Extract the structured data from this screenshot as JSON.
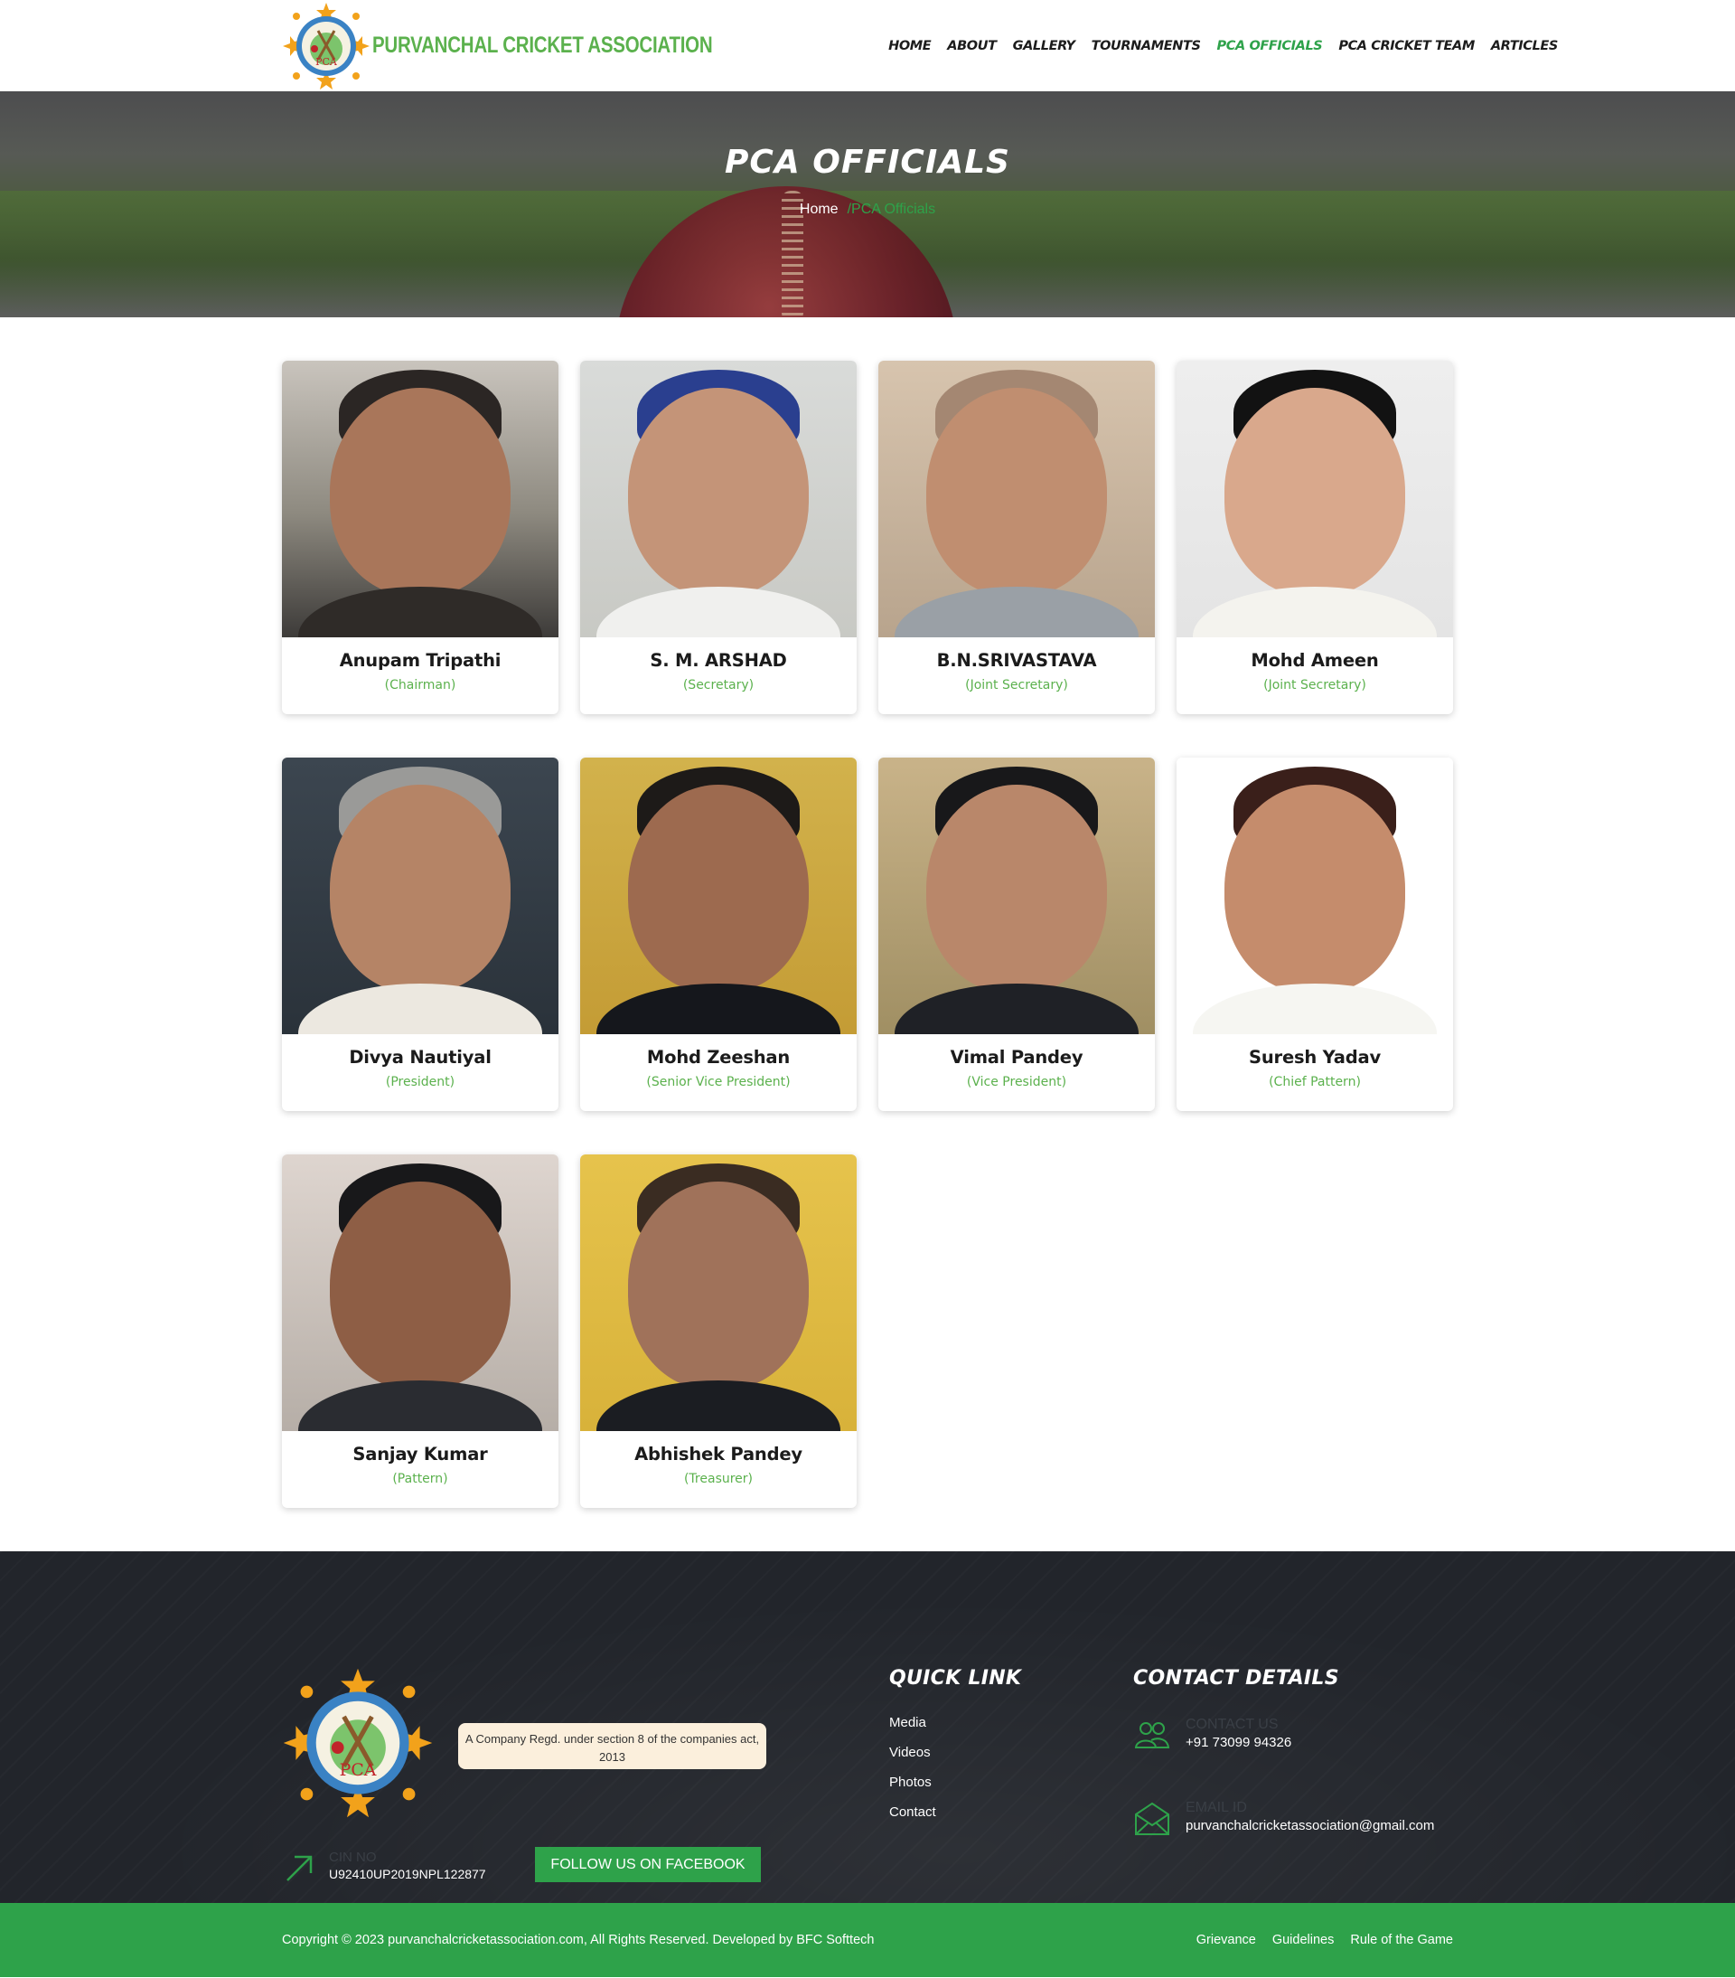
{
  "header": {
    "logo_text": "PURVANCHAL CRICKET ASSOCIATION",
    "logo_badge_text": "PCA",
    "nav": [
      {
        "label": "HOME",
        "active": false
      },
      {
        "label": "ABOUT",
        "active": false
      },
      {
        "label": "GALLERY",
        "active": false
      },
      {
        "label": "TOURNAMENTS",
        "active": false
      },
      {
        "label": "PCA OFFICIALS",
        "active": true
      },
      {
        "label": "PCA CRICKET TEAM",
        "active": false
      },
      {
        "label": "ARTICLES",
        "active": false
      }
    ]
  },
  "hero": {
    "title": "PCA OFFICIALS",
    "breadcrumb_home": "Home",
    "breadcrumb_current": "/PCA Officials"
  },
  "officials": [
    {
      "name": "Anupam Tripathi",
      "role": "(Chairman)"
    },
    {
      "name": "S. M. ARSHAD",
      "role": "(Secretary)"
    },
    {
      "name": "B.N.SRIVASTAVA",
      "role": "(Joint Secretary)"
    },
    {
      "name": "Mohd Ameen",
      "role": "(Joint Secretary)"
    },
    {
      "name": "Divya Nautiyal",
      "role": "(President)"
    },
    {
      "name": "Mohd Zeeshan",
      "role": "(Senior Vice President)"
    },
    {
      "name": "Vimal Pandey",
      "role": "(Vice President)"
    },
    {
      "name": "Suresh Yadav",
      "role": "(Chief Pattern)"
    },
    {
      "name": "Sanjay Kumar",
      "role": "(Pattern)"
    },
    {
      "name": "Abhishek Pandey",
      "role": "(Treasurer)"
    }
  ],
  "footer": {
    "logo_badge_text": "PCA",
    "company_note": "A Company Regd. under section 8 of the companies act, 2013",
    "cin_label": "CIN NO",
    "cin_value": "U92410UP2019NPL122877",
    "facebook_button": "FOLLOW US ON FACEBOOK",
    "quick_link_title": "QUICK LINK",
    "quick_links": [
      "Media",
      "Videos",
      "Photos",
      "Contact"
    ],
    "contact_title": "CONTACT DETAILS",
    "contact_us_label": "CONTACT US",
    "contact_us_value": "+91 73099 94326",
    "email_label": "EMAIL ID",
    "email_value": "purvanchalcricketassociation@gmail.com"
  },
  "bottom_bar": {
    "copyright": "Copyright © 2023 purvanchalcricketassociation.com, All Rights Reserved. Developed by BFC Softtech",
    "links": [
      "Grievance",
      "Guidelines",
      "Rule of the Game"
    ]
  },
  "colors": {
    "brand_green": "#2ea24a",
    "role_green": "#5bb14d",
    "footer_bg": "#22252b"
  }
}
